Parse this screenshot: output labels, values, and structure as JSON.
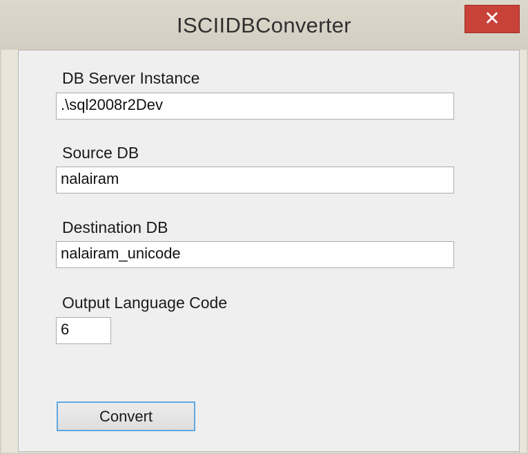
{
  "window": {
    "title": "ISCIIDBConverter",
    "close_glyph": "✕"
  },
  "form": {
    "db_server_label": "DB Server Instance",
    "db_server_value": ".\\sql2008r2Dev",
    "source_db_label": "Source DB",
    "source_db_value": "nalairam",
    "destination_db_label": "Destination DB",
    "destination_db_value": "nalairam_unicode",
    "language_code_label": "Output Language Code",
    "language_code_value": "6"
  },
  "actions": {
    "convert_label": "Convert"
  }
}
